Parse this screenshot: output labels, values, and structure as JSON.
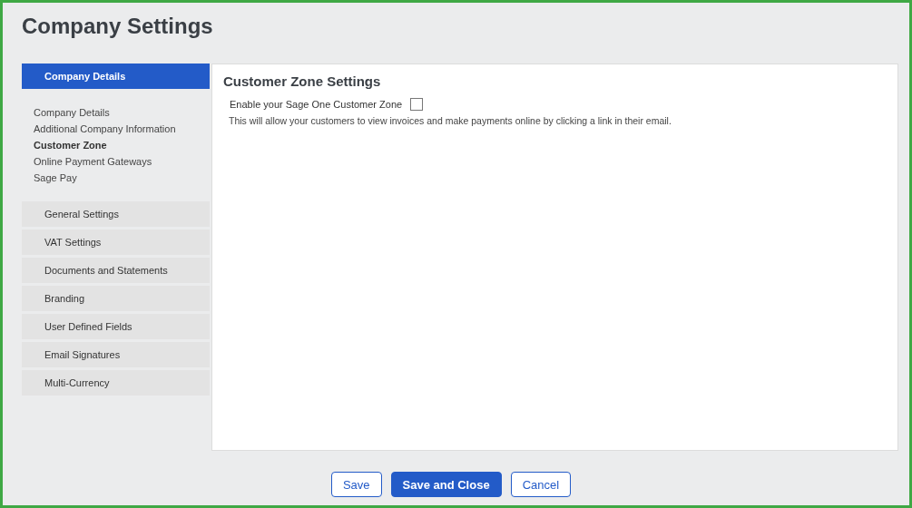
{
  "window": {
    "title": "Company Settings"
  },
  "sidebar": {
    "sections": [
      {
        "label": "Company Details",
        "selected": true,
        "children": [
          {
            "label": "Company Details",
            "selected": false
          },
          {
            "label": "Additional Company Information",
            "selected": false
          },
          {
            "label": "Customer Zone",
            "selected": true
          },
          {
            "label": "Online Payment Gateways",
            "selected": false
          },
          {
            "label": "Sage Pay",
            "selected": false
          }
        ]
      },
      {
        "label": "General Settings",
        "selected": false
      },
      {
        "label": "VAT Settings",
        "selected": false
      },
      {
        "label": "Documents and Statements",
        "selected": false
      },
      {
        "label": "Branding",
        "selected": false
      },
      {
        "label": "User Defined Fields",
        "selected": false
      },
      {
        "label": "Email Signatures",
        "selected": false
      },
      {
        "label": "Multi-Currency",
        "selected": false
      }
    ]
  },
  "panel": {
    "heading": "Customer Zone Settings",
    "option": {
      "label": "Enable your Sage One Customer Zone",
      "checked": false
    },
    "description": "This will allow your customers to view invoices and make payments online by clicking a link in their email."
  },
  "buttons": [
    {
      "label": "Save",
      "kind": "secondary"
    },
    {
      "label": "Save and Close",
      "kind": "primary"
    },
    {
      "label": "Cancel",
      "kind": "secondary"
    }
  ]
}
